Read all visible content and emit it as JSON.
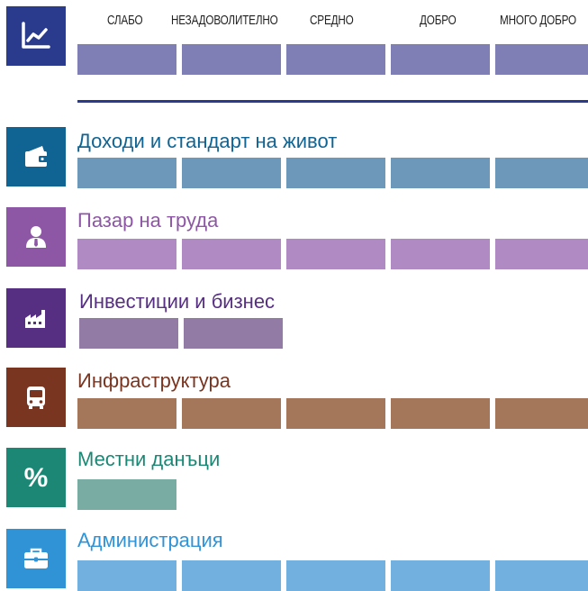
{
  "chart_data": {
    "type": "bar",
    "scale_labels": [
      "СЛАБО",
      "НЕЗАДОВОЛИТЕЛНО",
      "СРЕДНО",
      "ДОБРО",
      "МНОГО ДОБРО"
    ],
    "categories": [
      "Доходи и стандарт на живот",
      "Пазар на труда",
      "Инвестиции и бизнес",
      "Инфраструктура",
      "Местни данъци",
      "Администрация"
    ],
    "values": [
      5,
      5,
      2,
      5,
      1,
      5
    ],
    "xlim": [
      0,
      5
    ]
  },
  "header": {
    "icon": "line-chart-icon",
    "color": "#2a3a8c",
    "bar_color": "#7f7fb6"
  },
  "rows": [
    {
      "label": "Доходи и стандарт на живот",
      "icon": "wallet-icon",
      "icon_color": "#0f6493",
      "title_color": "#0f6493",
      "bar_color": "#6e98ba"
    },
    {
      "label": "Пазар на труда",
      "icon": "person-icon",
      "icon_color": "#8e57a6",
      "title_color": "#8e57a6",
      "bar_color": "#b08bc3"
    },
    {
      "label": "Инвестиции и бизнес",
      "icon": "factory-icon",
      "icon_color": "#572f82",
      "title_color": "#572f82",
      "bar_color": "#927ba4"
    },
    {
      "label": "Инфраструктура",
      "icon": "bus-icon",
      "icon_color": "#7a3520",
      "title_color": "#7a3520",
      "bar_color": "#a5775a"
    },
    {
      "label": "Местни данъци",
      "icon": "percent-icon",
      "icon_color": "#1c8774",
      "title_color": "#1c8774",
      "bar_color": "#79ada4"
    },
    {
      "label": "Администрация",
      "icon": "briefcase-icon",
      "icon_color": "#2f93d6",
      "title_color": "#2f93d6",
      "bar_color": "#72b0e0"
    }
  ]
}
